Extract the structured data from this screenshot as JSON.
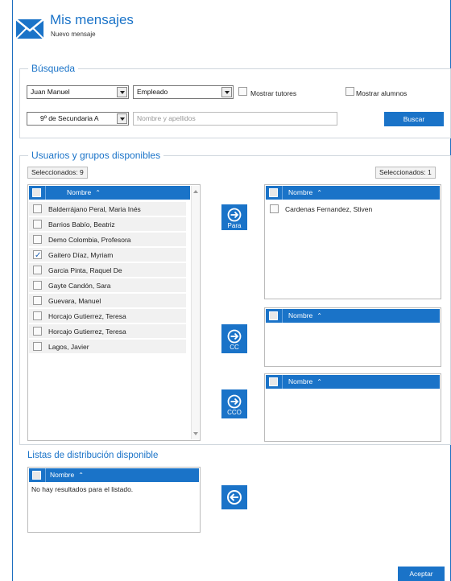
{
  "header": {
    "title": "Mis mensajes",
    "subtitle": "Nuevo mensaje",
    "icon": "envelope-icon",
    "accent_color": "#1a73c8"
  },
  "search": {
    "legend": "Búsqueda",
    "user_select": "Juan Manuel",
    "role_select": "Empleado",
    "show_tutors_label": "Mostrar tutores",
    "show_students_label": "Mostrar alumnos",
    "group_select": "9º de Secundaria A",
    "name_placeholder": "Nombre y apellidos",
    "search_button": "Buscar"
  },
  "users": {
    "legend": "Usuarios y grupos disponibles",
    "selected_left": "Seleccionados: 9",
    "selected_right": "Seleccionados: 1",
    "column_header": "Nombre",
    "available": [
      {
        "name": "Balderrájano Peral, Maria Inés",
        "checked": false
      },
      {
        "name": "Barrios Babío, Beatriz",
        "checked": false
      },
      {
        "name": "Demo Colombia, Profesora",
        "checked": false
      },
      {
        "name": "Gaitero Díaz, Myriam",
        "checked": true
      },
      {
        "name": "Garcia Pinta, Raquel De",
        "checked": false
      },
      {
        "name": "Gayte Candón, Sara",
        "checked": false
      },
      {
        "name": "Guevara, Manuel",
        "checked": false
      },
      {
        "name": "Horcajo Gutierrez, Teresa",
        "checked": false
      },
      {
        "name": "Horcajo Gutierrez, Teresa",
        "checked": false
      },
      {
        "name": "Lagos, Javier",
        "checked": false
      }
    ],
    "to_recipients": [
      {
        "name": "Cardenas Fernandez, Stiven",
        "checked": false
      }
    ],
    "para_button": "Para",
    "cc_button": "CC",
    "cco_button": "CCO"
  },
  "distribution": {
    "title": "Listas de distribución disponible",
    "column_header": "Nombre",
    "empty_message": "No hay resultados para el listado."
  },
  "footer": {
    "accept_button": "Aceptar"
  }
}
